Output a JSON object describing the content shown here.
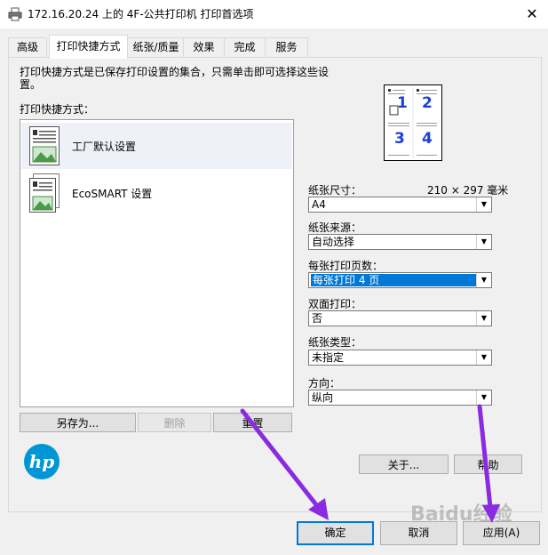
{
  "window": {
    "title": "172.16.20.24 上的 4F-公共打印机 打印首选项",
    "close_glyph": "✕"
  },
  "tabs": [
    {
      "label": "高级"
    },
    {
      "label": "打印快捷方式",
      "active": true
    },
    {
      "label": "纸张/质量"
    },
    {
      "label": "效果"
    },
    {
      "label": "完成"
    },
    {
      "label": "服务"
    }
  ],
  "shortcuts": {
    "description": "打印快捷方式是已保存打印设置的集合，只需单击即可选择这些设置。",
    "list_label": "打印快捷方式：",
    "items": [
      {
        "label": "工厂默认设置",
        "icon": "document-icon",
        "selected": true
      },
      {
        "label": "EcoSMART 设置",
        "icon": "eco-document-icon",
        "selected": false
      }
    ],
    "buttons": {
      "save_as": "另存为...",
      "delete": "删除",
      "reset": "重置"
    }
  },
  "preview": {
    "numbers": [
      "1",
      "2",
      "3",
      "4"
    ]
  },
  "fields": {
    "paper_size": {
      "label": "纸张尺寸：",
      "dimensions": "210 × 297 毫米",
      "value": "A4"
    },
    "paper_source": {
      "label": "纸张来源：",
      "value": "自动选择"
    },
    "pages_per_sheet": {
      "label": "每张打印页数：",
      "value": "每张打印 4 页"
    },
    "duplex": {
      "label": "双面打印：",
      "value": "否"
    },
    "paper_type": {
      "label": "纸张类型：",
      "value": "未指定"
    },
    "orientation": {
      "label": "方向：",
      "value": "纵向"
    }
  },
  "buttons": {
    "about": "关于...",
    "help": "帮助",
    "ok": "确定",
    "cancel": "取消",
    "apply": "应用(A)"
  },
  "logo_text": "hp",
  "watermark": "Baidu经验",
  "colors": {
    "accent": "#0078d7",
    "arrow": "#8a2be2",
    "hp_blue": "#0096d6"
  }
}
